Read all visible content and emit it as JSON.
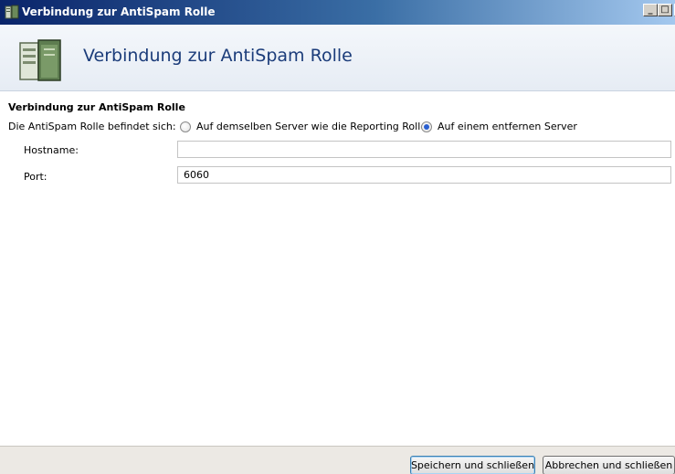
{
  "window": {
    "title": "Verbindung zur AntiSpam Rolle",
    "minimize_label": "_",
    "maximize_label": "□",
    "close_label": "×"
  },
  "header": {
    "title": "Verbindung zur AntiSpam Rolle",
    "icon": "server-icon"
  },
  "section": {
    "title": "Verbindung zur AntiSpam Rolle",
    "location_label": "Die AntiSpam Rolle befindet sich:",
    "options": [
      {
        "label": "Auf demselben Server wie die Reporting Rolle",
        "selected": false
      },
      {
        "label": "Auf einem entfernen Server",
        "selected": true
      }
    ]
  },
  "fields": {
    "hostname": {
      "label": "Hostname:",
      "value": ""
    },
    "port": {
      "label": "Port:",
      "value": "6060"
    }
  },
  "footer": {
    "save_label": "Speichern und schließen",
    "cancel_label": "Abbrechen und schließen"
  },
  "colors": {
    "accent": "#2a5fd0",
    "header_title": "#1b3c7a"
  }
}
